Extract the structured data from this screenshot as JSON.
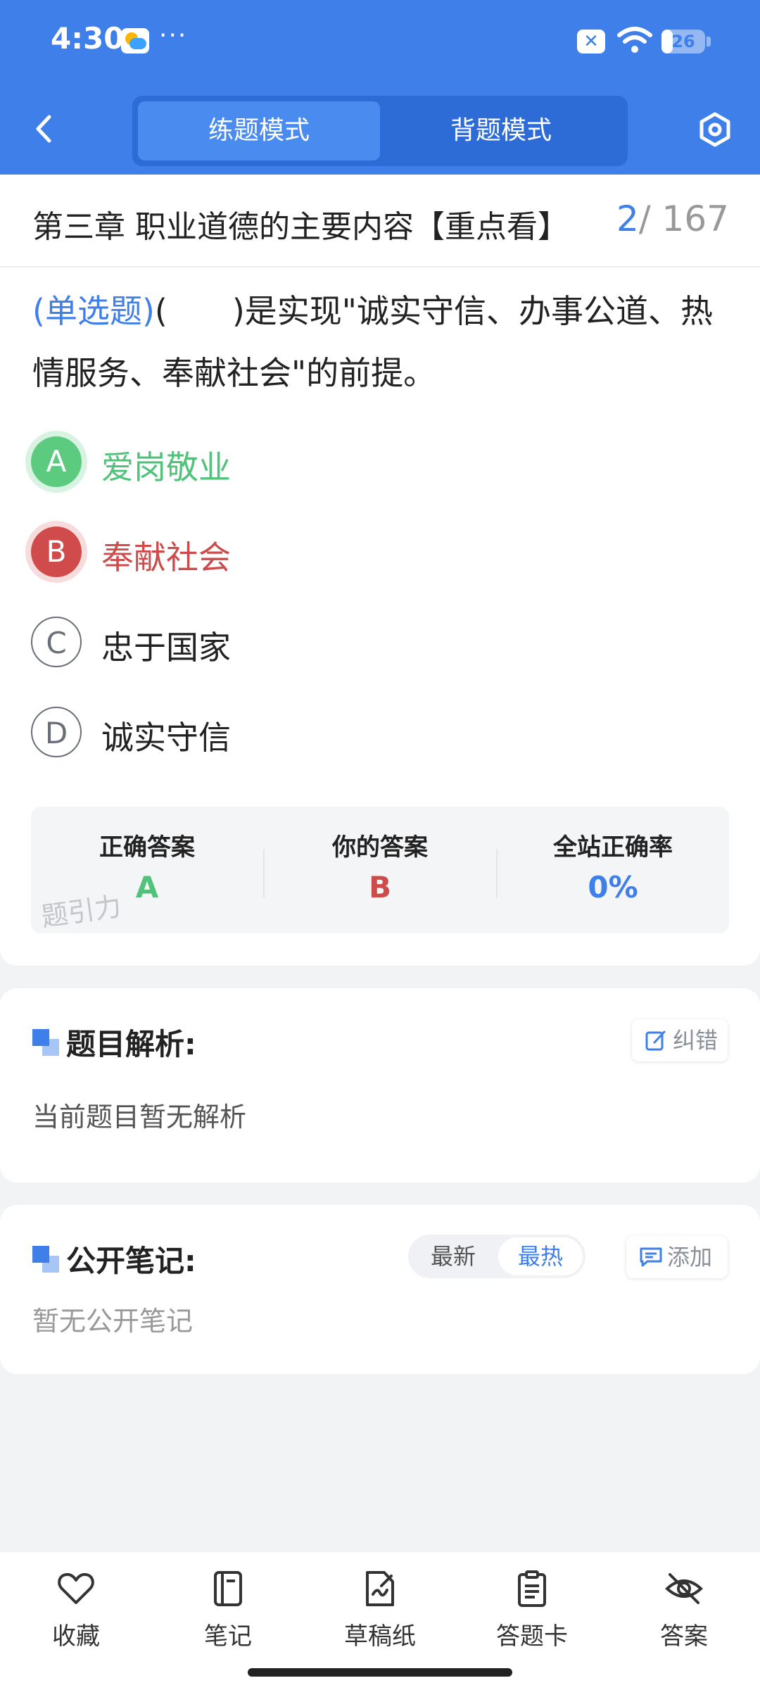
{
  "status_bar": {
    "time": "4:30",
    "more": "···",
    "battery": "26",
    "battery_fill": 0.26,
    "icons": [
      "weather-icon",
      "notification-x-icon",
      "wifi-icon",
      "battery-icon"
    ]
  },
  "header": {
    "tabs": [
      {
        "label": "练题模式",
        "active": true
      },
      {
        "label": "背题模式",
        "active": false
      }
    ],
    "back_icon": "chevron-left-icon",
    "settings_icon": "hexagon-settings-icon"
  },
  "question": {
    "chapter": "第三章 职业道德的主要内容【重点看】",
    "current": "2",
    "total": "/ 167",
    "type_label": "(单选题)",
    "text": "(　　)是实现\"诚实守信、办事公道、热情服务、奉献社会\"的前提。",
    "options": [
      {
        "letter": "A",
        "text": "爱岗敬业",
        "state": "correct"
      },
      {
        "letter": "B",
        "text": "奉献社会",
        "state": "wrong"
      },
      {
        "letter": "C",
        "text": "忠于国家",
        "state": "normal"
      },
      {
        "letter": "D",
        "text": "诚实守信",
        "state": "normal"
      }
    ]
  },
  "answer_summary": {
    "correct_label": "正确答案",
    "correct_value": "A",
    "yours_label": "你的答案",
    "yours_value": "B",
    "rate_label": "全站正确率",
    "rate_value": "0%",
    "watermark": "题引力",
    "colors": {
      "correct": "#52c27a",
      "wrong": "#cd4b4b",
      "rate": "#3f7fe9"
    }
  },
  "analysis": {
    "title": "题目解析:",
    "body": "当前题目暂无解析",
    "report_label": "纠错",
    "report_icon": "edit-icon"
  },
  "notes": {
    "title": "公开笔记:",
    "sort_new": "最新",
    "sort_hot": "最热",
    "add_label": "添加",
    "add_icon": "comment-icon",
    "empty": "暂无公开笔记"
  },
  "bottom_nav": [
    {
      "label": "收藏",
      "icon": "heart-icon"
    },
    {
      "label": "笔记",
      "icon": "notebook-icon"
    },
    {
      "label": "草稿纸",
      "icon": "draft-paper-icon"
    },
    {
      "label": "答题卡",
      "icon": "answer-sheet-icon"
    },
    {
      "label": "答案",
      "icon": "eye-off-icon"
    }
  ],
  "theme": {
    "primary": "#3f7fe9",
    "background": "#f2f3f5"
  }
}
